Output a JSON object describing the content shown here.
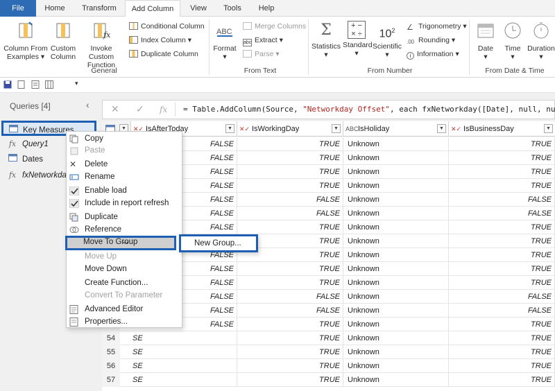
{
  "tabs": [
    "File",
    "Home",
    "Transform",
    "Add Column",
    "View",
    "Tools",
    "Help"
  ],
  "ribbon": {
    "general": {
      "column_from_examples": "Column From Examples",
      "custom_column": "Custom Column",
      "invoke_custom_function": "Invoke Custom Function",
      "conditional_column": "Conditional Column",
      "index_column": "Index Column",
      "duplicate_column": "Duplicate Column",
      "label": "General"
    },
    "from_text": {
      "format": "Format",
      "merge_columns": "Merge Columns",
      "extract": "Extract",
      "parse": "Parse",
      "label": "From Text"
    },
    "from_number": {
      "statistics": "Statistics",
      "standard": "Standard",
      "scientific": "Scientific",
      "trigonometry": "Trigonometry",
      "rounding": "Rounding",
      "information": "Information",
      "label": "From Number"
    },
    "from_date_time": {
      "date": "Date",
      "time": "Time",
      "duration": "Duration",
      "label": "From Date & Time"
    }
  },
  "queries": {
    "header": "Queries [4]",
    "items": [
      {
        "name": "Key Measures",
        "icon": "table-icon"
      },
      {
        "name": "Query1",
        "icon": "function-icon"
      },
      {
        "name": "Dates",
        "icon": "table-icon"
      },
      {
        "name": "fxNetworkda",
        "icon": "function-icon"
      }
    ]
  },
  "formula": {
    "prefix": "= Table.AddColumn(Source, ",
    "string": "\"Networkday Offset\"",
    "suffix": ", each fxNetworkday([Date], null, null,"
  },
  "columns": [
    "IsAfterToday",
    "IsWorkingDay",
    "IsHoliday",
    "IsBusinessDay"
  ],
  "rows": [
    {
      "num": "",
      "after": "FALSE",
      "working": "TRUE",
      "holiday": "Unknown",
      "business": "TRUE"
    },
    {
      "num": "",
      "after": "FALSE",
      "working": "TRUE",
      "holiday": "Unknown",
      "business": "TRUE"
    },
    {
      "num": "",
      "after": "FALSE",
      "working": "TRUE",
      "holiday": "Unknown",
      "business": "TRUE"
    },
    {
      "num": "",
      "after": "FALSE",
      "working": "TRUE",
      "holiday": "Unknown",
      "business": "TRUE"
    },
    {
      "num": "",
      "after": "FALSE",
      "working": "FALSE",
      "holiday": "Unknown",
      "business": "FALSE"
    },
    {
      "num": "",
      "after": "FALSE",
      "working": "FALSE",
      "holiday": "Unknown",
      "business": "FALSE"
    },
    {
      "num": "",
      "after": "FALSE",
      "working": "TRUE",
      "holiday": "Unknown",
      "business": "TRUE"
    },
    {
      "num": "",
      "after": "FALSE",
      "working": "TRUE",
      "holiday": "Unknown",
      "business": "TRUE"
    },
    {
      "num": "",
      "after": "FALSE",
      "working": "TRUE",
      "holiday": "Unknown",
      "business": "TRUE"
    },
    {
      "num": "",
      "after": "FALSE",
      "working": "TRUE",
      "holiday": "Unknown",
      "business": "TRUE"
    },
    {
      "num": "",
      "after": "FALSE",
      "working": "TRUE",
      "holiday": "Unknown",
      "business": "TRUE"
    },
    {
      "num": "",
      "after": "FALSE",
      "working": "FALSE",
      "holiday": "Unknown",
      "business": "FALSE"
    },
    {
      "num": "",
      "after": "FALSE",
      "working": "FALSE",
      "holiday": "Unknown",
      "business": "FALSE"
    },
    {
      "num": "",
      "after": "FALSE",
      "working": "TRUE",
      "holiday": "Unknown",
      "business": "TRUE"
    },
    {
      "num": "54",
      "after": "SE",
      "working": "TRUE",
      "holiday": "Unknown",
      "business": "TRUE"
    },
    {
      "num": "55",
      "after": "SE",
      "working": "TRUE",
      "holiday": "Unknown",
      "business": "TRUE"
    },
    {
      "num": "56",
      "after": "SE",
      "working": "TRUE",
      "holiday": "Unknown",
      "business": "TRUE"
    },
    {
      "num": "57",
      "after": "SE",
      "working": "TRUE",
      "holiday": "Unknown",
      "business": "TRUE"
    }
  ],
  "context_menu": {
    "items": [
      "Copy",
      "Paste",
      "Delete",
      "Rename",
      "Enable load",
      "Include in report refresh",
      "Duplicate",
      "Reference",
      "Move To Group",
      "Move Up",
      "Move Down",
      "Create Function...",
      "Convert To Parameter",
      "Advanced Editor",
      "Properties..."
    ],
    "submenu": "New Group..."
  },
  "colors": {
    "accent": "#1e5fb4",
    "file_tab": "#2e6bb5",
    "type_icon": "#c0392b"
  }
}
